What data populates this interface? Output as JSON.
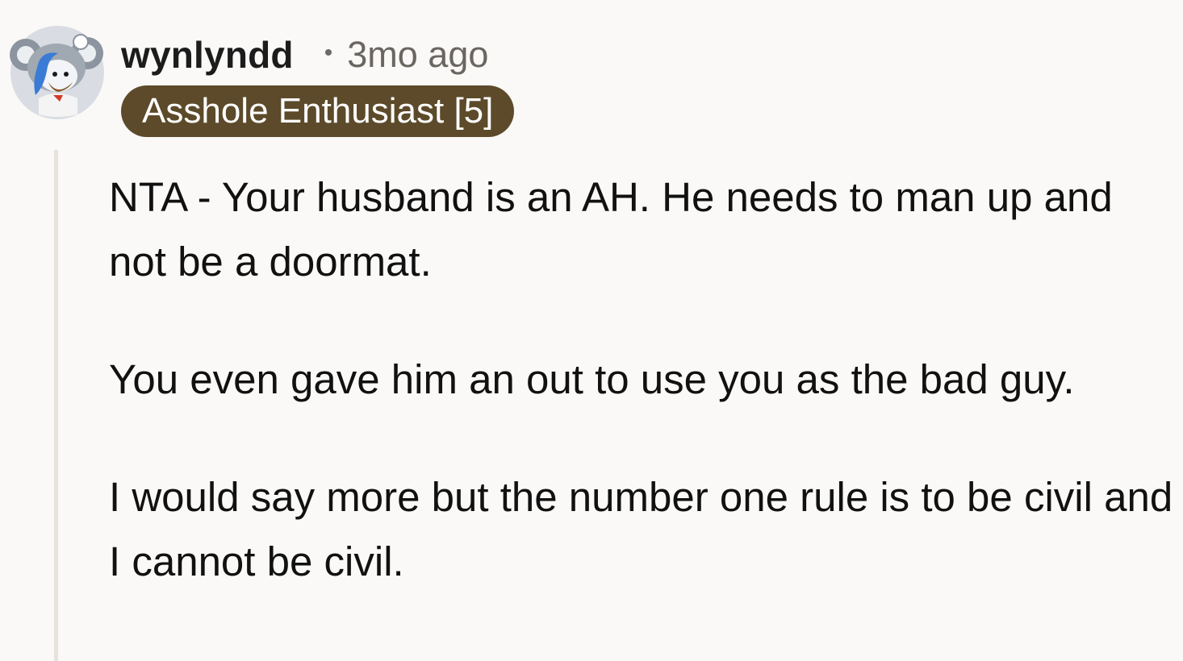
{
  "comment": {
    "username": "wynlyndd",
    "separator": "•",
    "timestamp": "3mo ago",
    "flair": "Asshole Enthusiast [5]",
    "avatar_icon": "koala-snoo-avatar-icon",
    "flair_color": "#5c4a2a",
    "paragraphs": [
      "NTA - Your husband is an AH. He needs to man up and not be a doormat.",
      "You even gave him an out to use you as the bad guy.",
      "I would say more but the number one rule is to be civil and I cannot be civil."
    ]
  }
}
